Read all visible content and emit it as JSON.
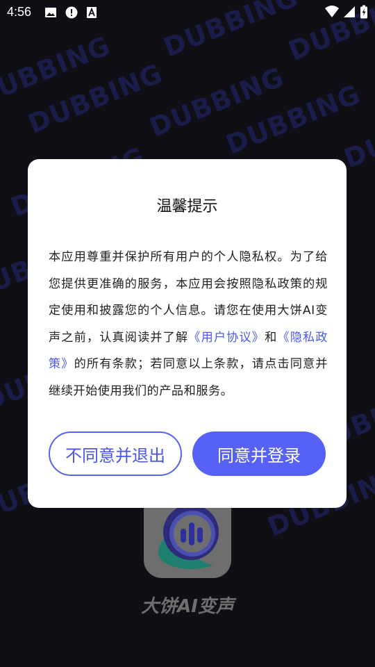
{
  "status_bar": {
    "time": "4:56"
  },
  "background": {
    "watermark_text": "DUBBING"
  },
  "dialog": {
    "title": "温馨提示",
    "body_part1": "本应用尊重并保护所有用户的个人隐私权。为了给您提供更准确的服务，本应用会按照隐私政策的规定使用和披露您的个人信息。请您在使用大饼AI变声之前，认真阅读并了解",
    "link_user_agreement": "《用户协议》",
    "body_and": "和",
    "link_privacy_policy": "《隐私政策》",
    "body_part2": "的所有条款；若同意以上条款，请点击同意并继续开始使用我们的产品和服务。",
    "decline_label": "不同意并退出",
    "accept_label": "同意并登录"
  },
  "app": {
    "name": "大饼AI变声"
  },
  "colors": {
    "accent": "#5761f5",
    "background": "#0f0f15",
    "watermark": "#1a1d4a"
  }
}
